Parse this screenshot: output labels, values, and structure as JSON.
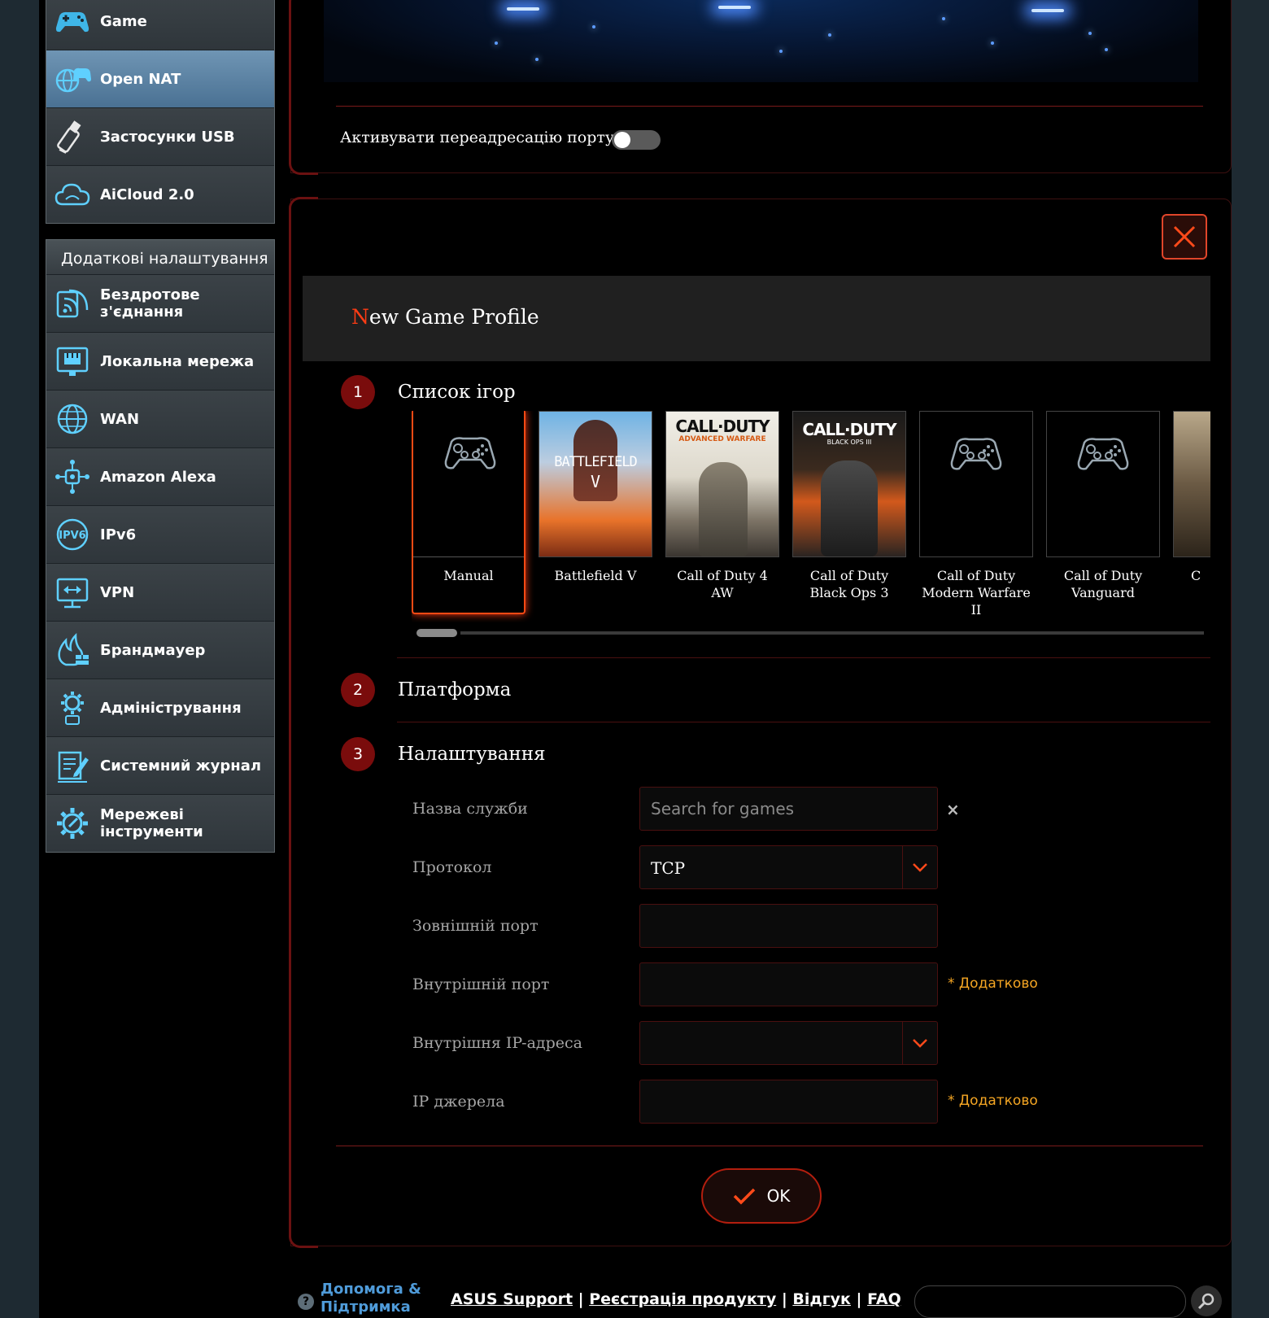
{
  "sidebar": {
    "top_items": [
      {
        "label": "Game",
        "icon": "gamepad-icon",
        "active": false
      },
      {
        "label": "Open NAT",
        "icon": "globe-gamepad-icon",
        "active": true
      },
      {
        "label": "Застосунки USB",
        "icon": "usb-icon",
        "active": false
      },
      {
        "label": "AiCloud 2.0",
        "icon": "cloud-icon",
        "active": false
      }
    ],
    "advanced_header": "Додаткові налаштування",
    "advanced_items": [
      {
        "label": "Бездротове з'єднання",
        "icon": "wireless-icon"
      },
      {
        "label": "Локальна мережа",
        "icon": "lan-icon"
      },
      {
        "label": "WAN",
        "icon": "globe-icon"
      },
      {
        "label": "Amazon Alexa",
        "icon": "alexa-icon"
      },
      {
        "label": "IPv6",
        "icon": "ipv6-icon"
      },
      {
        "label": "VPN",
        "icon": "vpn-icon"
      },
      {
        "label": "Брандмауер",
        "icon": "firewall-icon"
      },
      {
        "label": "Адміністрування",
        "icon": "admin-gear-icon"
      },
      {
        "label": "Системний журнал",
        "icon": "log-icon"
      },
      {
        "label": "Мережеві інструменти",
        "icon": "network-tools-icon"
      }
    ]
  },
  "port_forward": {
    "toggle_label": "Активувати переадресацію порту",
    "enabled": false
  },
  "dialog": {
    "title_first": "N",
    "title_rest": "ew Game Profile",
    "steps": [
      {
        "number": "1",
        "title": "Список ігор"
      },
      {
        "number": "2",
        "title": "Платформа"
      },
      {
        "number": "3",
        "title": "Налаштування"
      }
    ],
    "games": [
      {
        "name": "Manual",
        "cover": "gamepad",
        "selected": true
      },
      {
        "name": "Battlefield V",
        "cover": "battlefield",
        "selected": false
      },
      {
        "name": "Call of Duty 4 AW",
        "cover": "cod-aw",
        "selected": false
      },
      {
        "name": "Call of Duty Black Ops 3",
        "cover": "cod-bo3",
        "selected": false
      },
      {
        "name": "Call of Duty Modern Warfare II",
        "cover": "gamepad",
        "selected": false
      },
      {
        "name": "Call of Duty Vanguard",
        "cover": "gamepad",
        "selected": false
      },
      {
        "name": "C",
        "cover": "partial",
        "selected": false
      }
    ],
    "cover_text": {
      "battlefield": "BATTLEFIELD",
      "battlefield_sub": "V",
      "cod": "CALL·DUTY",
      "cod_aw_sub": "ADVANCED WARFARE",
      "cod_bo3_sub": "BLACK OPS III"
    },
    "fields": {
      "service_name": {
        "label": "Назва служби",
        "placeholder": "Search for games",
        "value": ""
      },
      "protocol": {
        "label": "Протокол",
        "value": "TCP"
      },
      "external_port": {
        "label": "Зовнішній порт",
        "value": ""
      },
      "internal_port": {
        "label": "Внутрішній порт",
        "value": "",
        "note": "* Додатково"
      },
      "internal_ip": {
        "label": "Внутрішня IP-адреса",
        "value": ""
      },
      "source_ip": {
        "label": "IP джерела",
        "value": "",
        "note": "* Додатково"
      }
    },
    "clear_symbol": "×",
    "ok_label": "OK"
  },
  "footer": {
    "help_line1": "Допомога &",
    "help_line2": "Підтримка",
    "links": [
      "ASUS Support",
      "Реєстрація продукту",
      "Відгук",
      "FAQ"
    ],
    "separator": " | "
  },
  "colors": {
    "accent": "#ff3c14",
    "dark_red": "#7a0c0c",
    "optional": "#f5a623",
    "active_menu": "#5b82a3"
  }
}
